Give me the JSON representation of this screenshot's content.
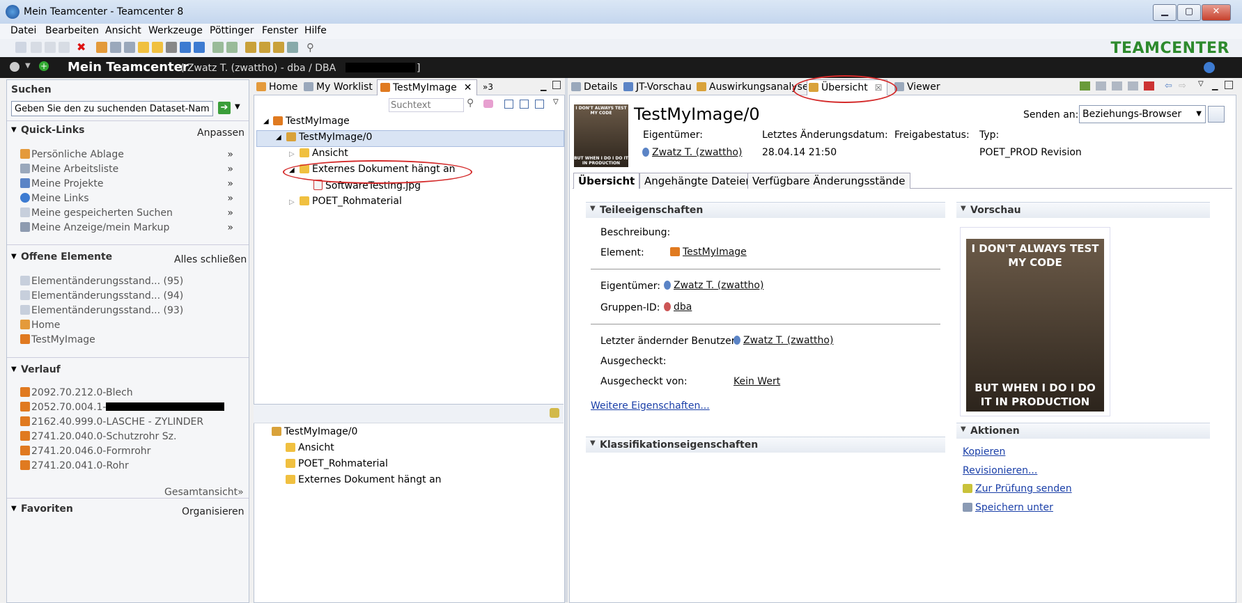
{
  "window": {
    "title": "Mein Teamcenter - Teamcenter 8",
    "min": "▁",
    "max": "▢",
    "close": "✕"
  },
  "menu": [
    "Datei",
    "Bearbeiten",
    "Ansicht",
    "Werkzeuge",
    "Pöttinger",
    "Fenster",
    "Hilfe"
  ],
  "brand": "TEAMCENTER",
  "appbar": {
    "title": "Mein Teamcenter",
    "user": "( Zwatz T. (zwattho) - dba / DBA",
    "close_bracket": "]"
  },
  "left": {
    "search": {
      "title": "Suchen",
      "placeholder": "Geben Sie den zu suchenden Dataset-Nam"
    },
    "quicklinks": {
      "title": "Quick-Links",
      "action": "Anpassen",
      "items": [
        "Persönliche Ablage",
        "Meine Arbeitsliste",
        "Meine Projekte",
        "Meine Links",
        "Meine gespeicherten Suchen",
        "Meine Anzeige/mein Markup"
      ],
      "chev": "»"
    },
    "open": {
      "title": "Offene Elemente",
      "action": "Alles schließen",
      "items": [
        "Elementänderungsstand... (95)",
        "Elementänderungsstand... (94)",
        "Elementänderungsstand... (93)",
        "Home",
        "TestMyImage"
      ]
    },
    "history": {
      "title": "Verlauf",
      "items": [
        "2092.70.212.0-Blech",
        "2052.70.004.1-",
        "2162.40.999.0-LASCHE - ZYLINDER",
        "2741.20.040.0-Schutzrohr Sz.",
        "2741.20.046.0-Formrohr",
        "2741.20.041.0-Rohr"
      ],
      "overview": "Gesamtansicht",
      "overview_chev": "»"
    },
    "favorites": {
      "title": "Favoriten",
      "action": "Organisieren"
    }
  },
  "middle": {
    "tabs": [
      "Home",
      "My Worklist",
      "TestMyImage"
    ],
    "overflow": "»3",
    "search_placeholder": "Suchtext",
    "tree": {
      "root": "TestMyImage",
      "rev": "TestMyImage/0",
      "children": [
        "Ansicht",
        "Externes Dokument hängt an",
        "SoftwareTesting.jpg",
        "POET_Rohmaterial"
      ]
    },
    "bottom": {
      "root": "TestMyImage/0",
      "children": [
        "Ansicht",
        "POET_Rohmaterial",
        "Externes Dokument hängt an"
      ]
    }
  },
  "right": {
    "tabs": [
      "Details",
      "JT-Vorschau",
      "Auswirkungsanalyse",
      "Übersicht",
      "Viewer"
    ],
    "header": {
      "title": "TestMyImage/0",
      "owner_label": "Eigentümer:",
      "owner": "Zwatz T. (zwattho)",
      "date_label": "Letztes Änderungsdatum:",
      "date": "28.04.14 21:50",
      "release_label": "Freigabestatus:",
      "type_label": "Typ:",
      "type": "POET_PROD Revision",
      "send_label": "Senden an:",
      "send_value": "Beziehungs-Browser"
    },
    "subtabs": [
      "Übersicht",
      "Angehängte Dateien",
      "Verfügbare Änderungsstände"
    ],
    "props": {
      "section": "Teileeigenschaften",
      "desc_label": "Beschreibung:",
      "element_label": "Element:",
      "element_value": "TestMyImage",
      "owner_label": "Eigentümer:",
      "owner_value": "Zwatz T. (zwattho)",
      "group_label": "Gruppen-ID:",
      "group_value": "dba",
      "last_user_label": "Letzter ändernder Benutzer:",
      "last_user_value": "Zwatz T. (zwattho)",
      "checked_out_label": "Ausgecheckt:",
      "checked_out_by_label": "Ausgecheckt von:",
      "checked_out_by_value": "Kein Wert",
      "more": "Weitere Eigenschaften..."
    },
    "classification": "Klassifikationseigenschaften",
    "preview": {
      "section": "Vorschau",
      "top_text": "I DON'T ALWAYS TEST MY CODE",
      "bottom_text": "BUT WHEN I DO I DO IT IN PRODUCTION",
      "thumb_top": "I DON'T ALWAYS TEST MY CODE",
      "thumb_bottom": "BUT WHEN I DO I DO IT IN PRODUCTION"
    },
    "actions": {
      "section": "Aktionen",
      "items": [
        "Kopieren",
        "Revisionieren...",
        "Zur Prüfung senden",
        "Speichern unter"
      ]
    }
  }
}
